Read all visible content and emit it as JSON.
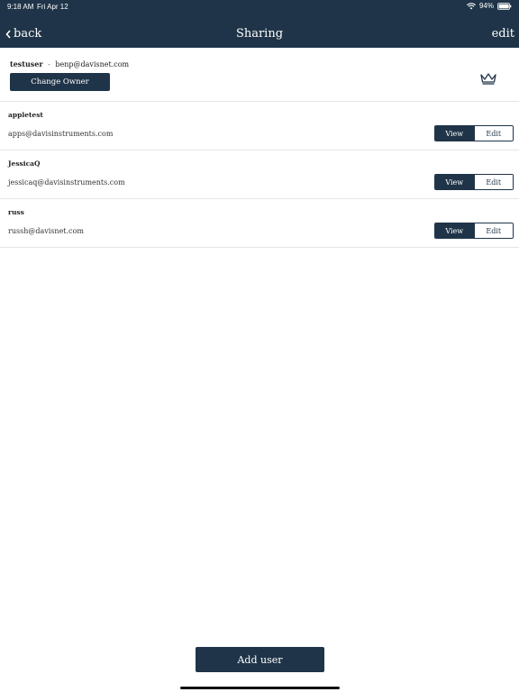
{
  "status": {
    "time": "9:18 AM",
    "date": "Fri Apr 12",
    "battery": "94%"
  },
  "nav": {
    "back_label": "back",
    "title": "Sharing",
    "edit_label": "edit"
  },
  "owner": {
    "username": "testuser",
    "separator": "-",
    "email": "benp@davisnet.com",
    "change_owner_label": "Change Owner",
    "icon": "crown-icon"
  },
  "users": [
    {
      "name": "appletest",
      "email": "apps@davisinstruments.com",
      "view_label": "View",
      "edit_label": "Edit",
      "selected": "View"
    },
    {
      "name": "JessicaQ",
      "email": "jessicaq@davisinstruments.com",
      "view_label": "View",
      "edit_label": "Edit",
      "selected": "View"
    },
    {
      "name": "russ",
      "email": "russh@davisnet.com",
      "view_label": "View",
      "edit_label": "Edit",
      "selected": "View"
    }
  ],
  "add_user_label": "Add user",
  "colors": {
    "navy": "#1f3448",
    "divider": "#e3e6ea",
    "background": "#ffffff"
  }
}
